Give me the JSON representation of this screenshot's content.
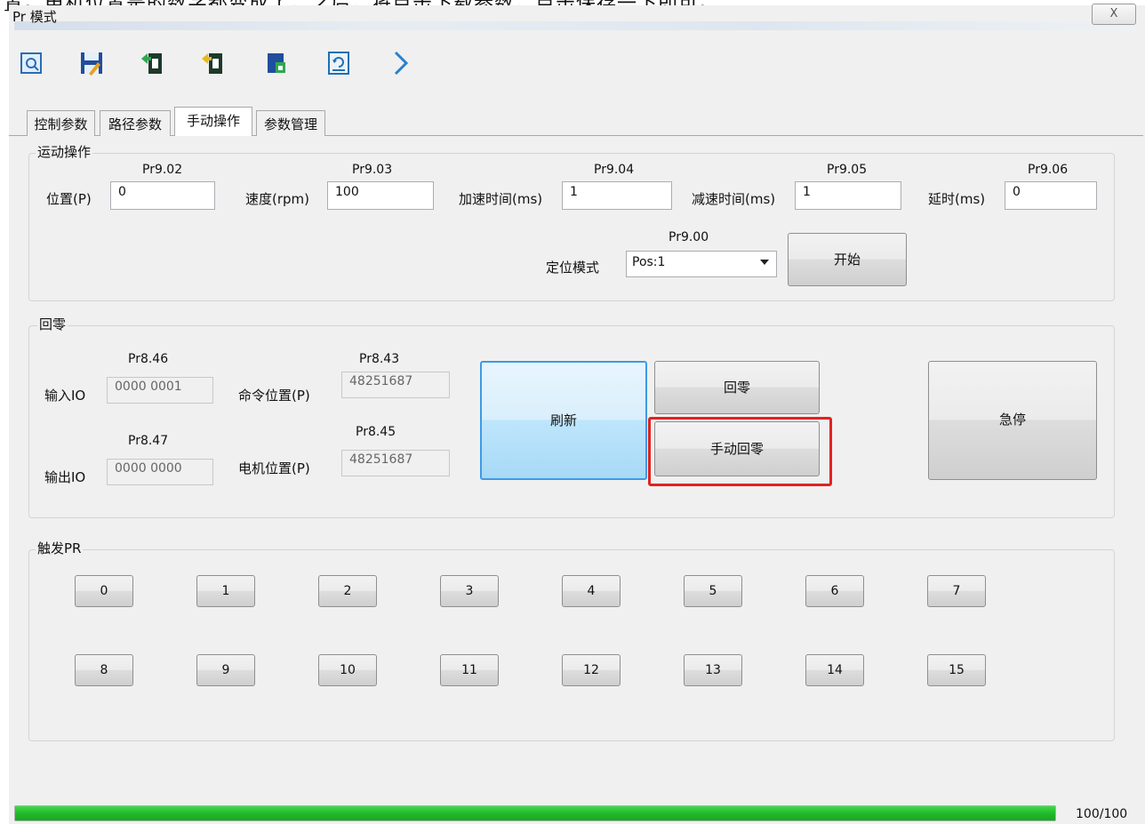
{
  "top_caption": "置。电机位置是的数字都变成了，之后，将点击下载参数，点击保存一下即可。",
  "window": {
    "title": "Pr 模式",
    "close_glyph": "X"
  },
  "toolbar": {
    "icons": [
      "open-icon",
      "save-icon",
      "upload-icon",
      "download-icon",
      "save-to-drive-icon",
      "reset-icon",
      "next-icon"
    ]
  },
  "tabs": [
    {
      "label": "控制参数"
    },
    {
      "label": "路径参数"
    },
    {
      "label": "手动操作"
    },
    {
      "label": "参数管理"
    }
  ],
  "motion": {
    "title": "运动操作",
    "fields": [
      {
        "param": "Pr9.02",
        "label": "位置(P)",
        "value": "0"
      },
      {
        "param": "Pr9.03",
        "label": "速度(rpm)",
        "value": "100"
      },
      {
        "param": "Pr9.04",
        "label": "加速时间(ms)",
        "value": "1"
      },
      {
        "param": "Pr9.05",
        "label": "减速时间(ms)",
        "value": "1"
      },
      {
        "param": "Pr9.06",
        "label": "延时(ms)",
        "value": "0"
      }
    ],
    "mode": {
      "param": "Pr9.00",
      "label": "定位模式",
      "value": "Pos:1"
    },
    "start_label": "开始"
  },
  "homing": {
    "title": "回零",
    "input_io": {
      "param": "Pr8.46",
      "label": "输入IO",
      "value": "0000 0001"
    },
    "output_io": {
      "param": "Pr8.47",
      "label": "输出IO",
      "value": "0000 0000"
    },
    "cmd_pos": {
      "param": "Pr8.43",
      "label": "命令位置(P)",
      "value": "48251687"
    },
    "motor_pos": {
      "param": "Pr8.45",
      "label": "电机位置(P)",
      "value": "48251687"
    },
    "refresh_label": "刷新",
    "home_label": "回零",
    "manual_home_label": "手动回零",
    "estop_label": "急停"
  },
  "trigger": {
    "title": "触发PR",
    "buttons": [
      "0",
      "1",
      "2",
      "3",
      "4",
      "5",
      "6",
      "7",
      "8",
      "9",
      "10",
      "11",
      "12",
      "13",
      "14",
      "15"
    ]
  },
  "progress": {
    "value": 1.0,
    "text": "100/100"
  },
  "colors": {
    "progress": "#22b92c",
    "highlight": "#e02222",
    "refresh": "#bee6fd"
  }
}
